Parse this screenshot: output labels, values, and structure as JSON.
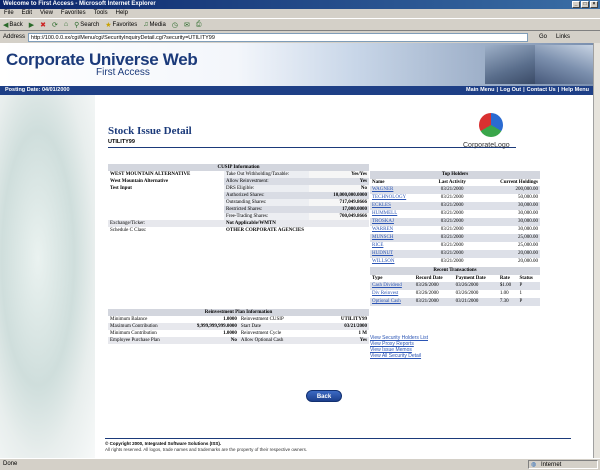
{
  "window": {
    "title": "Welcome to First Access - Microsoft Internet Explorer"
  },
  "menu": [
    "File",
    "Edit",
    "View",
    "Favorites",
    "Tools",
    "Help"
  ],
  "toolbar": {
    "back": "Back",
    "search": "Search",
    "favorites": "Favorites",
    "media": "Media"
  },
  "address": {
    "label": "Address",
    "url": "http://100.0.0.xx/cgi/Menu/cgi/SecurityInquiryDetail.cgi?security=UTILITY99",
    "go": "Go",
    "links": "Links"
  },
  "banner": {
    "title": "Corporate Universe Web",
    "subtitle": "First Access"
  },
  "nav": {
    "posting_date": "Posting Date: 04/01/2000",
    "links": [
      "Main Menu",
      "|",
      "Log Out",
      "|",
      "Contact Us",
      "|",
      "Help Menu"
    ]
  },
  "page": {
    "title": "Stock Issue Detail",
    "subtitle": "UTILITY99",
    "logo_text": "CorporateLogo"
  },
  "cusip": {
    "header": "CUSIP Information",
    "company": "WEST MOUNTAIN ALTERNATIVE",
    "company2": "West Mountain Alternative",
    "company3": "Test Input",
    "rows": [
      {
        "k": "Take Out Withholding/Taxable:",
        "v": "Yes/Yes"
      },
      {
        "k": "Allow Reinvestment:",
        "v": "Yes"
      },
      {
        "k": "DRS Eligible:",
        "v": "No"
      },
      {
        "k": "Authorized Shares:",
        "v": "10,000,000.0000"
      },
      {
        "k": "Outstanding Shares:",
        "v": "717,049.8666"
      },
      {
        "k": "Restricted Shares:",
        "v": "17,000.0000"
      },
      {
        "k": "Free-Trading Shares:",
        "v": "700,049.8666"
      }
    ],
    "exchange_label": "Exchange/Ticker:",
    "exchange_value": "Not Applicable/WMTN",
    "schedule_label": "Schedule C Class:",
    "schedule_value": "OTHER CORPORATE AGENCIES"
  },
  "reinvest": {
    "header": "Reinvestment Plan Information",
    "rows": [
      {
        "k1": "Minimum Balance",
        "v1": "1.0000",
        "k2": "Reinvestment CUSIP",
        "v2": "UTILITY99"
      },
      {
        "k1": "Maximum Contribution",
        "v1": "9,999,999,999.0000",
        "k2": "Start Date",
        "v2": "03/21/2000"
      },
      {
        "k1": "Minimum Contribution",
        "v1": "1.0000",
        "k2": "Reinvestment Cycle",
        "v2": "1 M"
      },
      {
        "k1": "Employee Purchase Plan",
        "v1": "No",
        "k2": "Allow Optional Cash",
        "v2": "Yes"
      }
    ]
  },
  "holders": {
    "header": "Top Holders",
    "cols": [
      "Name",
      "Last Activity",
      "Current Holdings"
    ],
    "rows": [
      {
        "n": "WAGNER",
        "d": "03/21/2000",
        "h": "200,000.00"
      },
      {
        "n": "TECHNOLOGY",
        "d": "03/21/2000",
        "h": "50,000.00"
      },
      {
        "n": "ECKLES",
        "d": "03/21/2000",
        "h": "30,000.00"
      },
      {
        "n": "HUMMELL",
        "d": "03/21/2000",
        "h": "30,000.00"
      },
      {
        "n": "TROSKAJ",
        "d": "03/21/2000",
        "h": "30,000.00"
      },
      {
        "n": "WARREN",
        "d": "03/21/2000",
        "h": "30,000.00"
      },
      {
        "n": "MUNSCH",
        "d": "03/21/2000",
        "h": "25,000.00"
      },
      {
        "n": "RICE",
        "d": "03/21/2000",
        "h": "25,000.00"
      },
      {
        "n": "HUDNUT",
        "d": "03/21/2000",
        "h": "20,000.00"
      },
      {
        "n": "WILLSON",
        "d": "03/21/2000",
        "h": "20,000.00"
      }
    ]
  },
  "transactions": {
    "header": "Recent Transactions",
    "cols": [
      "Type",
      "Record Date",
      "Payment Date",
      "Rate",
      "Status"
    ],
    "rows": [
      {
        "t": "Cash Dividend",
        "r": "03/26/2000",
        "p": "03/26/2000",
        "rate": "$1.00",
        "s": "P"
      },
      {
        "t": "Div Reinvest",
        "r": "03/26/2000",
        "p": "03/26/2000",
        "rate": "1.00",
        "s": "1"
      },
      {
        "t": "Optional Cash",
        "r": "03/21/2000",
        "p": "03/21/2000",
        "rate": "7.30",
        "s": "P"
      }
    ]
  },
  "links": [
    "View Security Holders List",
    "View Proxy Reports",
    "View Issue Memos",
    "View All Security Detail"
  ],
  "back": "Back",
  "footer": {
    "line1": "© Copyright 2000, Integrated Software Solutions (ISS).",
    "line2": "All rights reserved. All logos, trade names and trademarks are the property of their respective owners."
  },
  "status": {
    "left": "Done",
    "right": "Internet"
  }
}
